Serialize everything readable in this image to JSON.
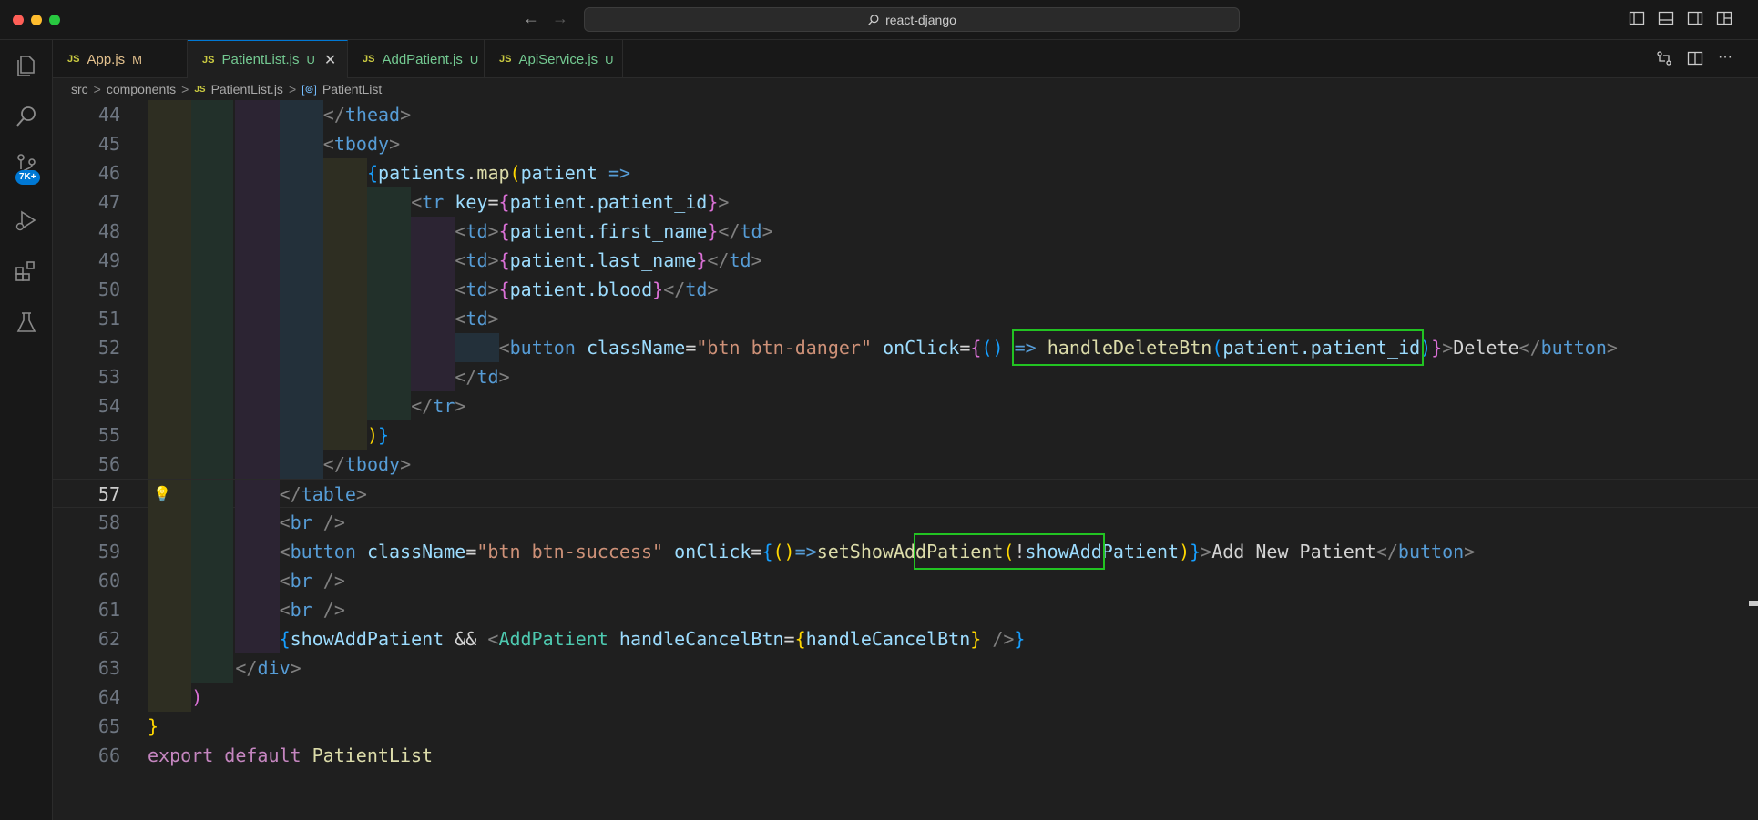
{
  "window": {
    "search_text": "react-django"
  },
  "activity": {
    "scm_badge": "7K+"
  },
  "tabs": [
    {
      "icon": "JS",
      "name": "App.js",
      "status": "M"
    },
    {
      "icon": "JS",
      "name": "PatientList.js",
      "status": "U",
      "active": true
    },
    {
      "icon": "JS",
      "name": "AddPatient.js",
      "status": "U"
    },
    {
      "icon": "JS",
      "name": "ApiService.js",
      "status": "U"
    }
  ],
  "breadcrumb": {
    "items": [
      "src",
      "components",
      "PatientList.js",
      "PatientList"
    ],
    "separator": ">",
    "file_icon": "JS"
  },
  "editor": {
    "current_line": 57,
    "lines": [
      {
        "n": "44",
        "tokens": [
          {
            "t": "</",
            "c": "tg"
          },
          {
            "t": "thead",
            "c": "tn"
          },
          {
            "t": ">",
            "c": "tg"
          }
        ]
      },
      {
        "n": "45",
        "tokens": [
          {
            "t": "<",
            "c": "tg"
          },
          {
            "t": "tbody",
            "c": "tn"
          },
          {
            "t": ">",
            "c": "tg"
          }
        ]
      },
      {
        "n": "46",
        "tokens": [
          {
            "t": "{",
            "c": "br3"
          },
          {
            "t": "patients",
            "c": "at"
          },
          {
            "t": ".",
            "c": "op"
          },
          {
            "t": "map",
            "c": "fn"
          },
          {
            "t": "(",
            "c": "br1"
          },
          {
            "t": "patient",
            "c": "at"
          },
          {
            "t": " ",
            "c": "op"
          },
          {
            "t": "=>",
            "c": "ar"
          }
        ]
      },
      {
        "n": "47",
        "tokens": [
          {
            "t": "<",
            "c": "tg"
          },
          {
            "t": "tr",
            "c": "tn"
          },
          {
            "t": " ",
            "c": "op"
          },
          {
            "t": "key",
            "c": "at"
          },
          {
            "t": "=",
            "c": "op"
          },
          {
            "t": "{",
            "c": "br2"
          },
          {
            "t": "patient.patient_id",
            "c": "at"
          },
          {
            "t": "}",
            "c": "br2"
          },
          {
            "t": ">",
            "c": "tg"
          }
        ]
      },
      {
        "n": "48",
        "tokens": [
          {
            "t": "<",
            "c": "tg"
          },
          {
            "t": "td",
            "c": "tn"
          },
          {
            "t": ">",
            "c": "tg"
          },
          {
            "t": "{",
            "c": "br2"
          },
          {
            "t": "patient.first_name",
            "c": "at"
          },
          {
            "t": "}",
            "c": "br2"
          },
          {
            "t": "</",
            "c": "tg"
          },
          {
            "t": "td",
            "c": "tn"
          },
          {
            "t": ">",
            "c": "tg"
          }
        ]
      },
      {
        "n": "49",
        "tokens": [
          {
            "t": "<",
            "c": "tg"
          },
          {
            "t": "td",
            "c": "tn"
          },
          {
            "t": ">",
            "c": "tg"
          },
          {
            "t": "{",
            "c": "br2"
          },
          {
            "t": "patient.last_name",
            "c": "at"
          },
          {
            "t": "}",
            "c": "br2"
          },
          {
            "t": "</",
            "c": "tg"
          },
          {
            "t": "td",
            "c": "tn"
          },
          {
            "t": ">",
            "c": "tg"
          }
        ]
      },
      {
        "n": "50",
        "tokens": [
          {
            "t": "<",
            "c": "tg"
          },
          {
            "t": "td",
            "c": "tn"
          },
          {
            "t": ">",
            "c": "tg"
          },
          {
            "t": "{",
            "c": "br2"
          },
          {
            "t": "patient.blood",
            "c": "at"
          },
          {
            "t": "}",
            "c": "br2"
          },
          {
            "t": "</",
            "c": "tg"
          },
          {
            "t": "td",
            "c": "tn"
          },
          {
            "t": ">",
            "c": "tg"
          }
        ]
      },
      {
        "n": "51",
        "tokens": [
          {
            "t": "<",
            "c": "tg"
          },
          {
            "t": "td",
            "c": "tn"
          },
          {
            "t": ">",
            "c": "tg"
          }
        ]
      },
      {
        "n": "52",
        "tokens": [
          {
            "t": "<",
            "c": "tg"
          },
          {
            "t": "button",
            "c": "tn"
          },
          {
            "t": " ",
            "c": "op"
          },
          {
            "t": "className",
            "c": "at"
          },
          {
            "t": "=",
            "c": "op"
          },
          {
            "t": "\"btn btn-danger\"",
            "c": "st"
          },
          {
            "t": " ",
            "c": "op"
          },
          {
            "t": "onClick",
            "c": "at"
          },
          {
            "t": "=",
            "c": "op"
          },
          {
            "t": "{",
            "c": "br2"
          },
          {
            "t": "()",
            "c": "br3"
          },
          {
            "t": " ",
            "c": "op"
          },
          {
            "t": "=>",
            "c": "ar"
          },
          {
            "t": " ",
            "c": "op"
          },
          {
            "t": "handleDeleteBtn",
            "c": "fn"
          },
          {
            "t": "(",
            "c": "br3"
          },
          {
            "t": "patient.patient_id",
            "c": "at"
          },
          {
            "t": ")",
            "c": "br3"
          },
          {
            "t": "}",
            "c": "br2"
          },
          {
            "t": ">",
            "c": "tg"
          },
          {
            "t": "Delete",
            "c": "tx"
          },
          {
            "t": "</",
            "c": "tg"
          },
          {
            "t": "button",
            "c": "tn"
          },
          {
            "t": ">",
            "c": "tg"
          }
        ]
      },
      {
        "n": "53",
        "tokens": [
          {
            "t": "</",
            "c": "tg"
          },
          {
            "t": "td",
            "c": "tn"
          },
          {
            "t": ">",
            "c": "tg"
          }
        ]
      },
      {
        "n": "54",
        "tokens": [
          {
            "t": "</",
            "c": "tg"
          },
          {
            "t": "tr",
            "c": "tn"
          },
          {
            "t": ">",
            "c": "tg"
          }
        ]
      },
      {
        "n": "55",
        "tokens": [
          {
            "t": ")",
            "c": "br1"
          },
          {
            "t": "}",
            "c": "br3"
          }
        ]
      },
      {
        "n": "56",
        "tokens": [
          {
            "t": "</",
            "c": "tg"
          },
          {
            "t": "tbody",
            "c": "tn"
          },
          {
            "t": ">",
            "c": "tg"
          }
        ]
      },
      {
        "n": "57",
        "tokens": [
          {
            "t": "</",
            "c": "tg"
          },
          {
            "t": "table",
            "c": "tn"
          },
          {
            "t": ">",
            "c": "tg"
          }
        ]
      },
      {
        "n": "58",
        "tokens": [
          {
            "t": "<",
            "c": "tg"
          },
          {
            "t": "br",
            "c": "tn"
          },
          {
            "t": " />",
            "c": "tg"
          }
        ]
      },
      {
        "n": "59",
        "tokens": [
          {
            "t": "<",
            "c": "tg"
          },
          {
            "t": "button",
            "c": "tn"
          },
          {
            "t": " ",
            "c": "op"
          },
          {
            "t": "className",
            "c": "at"
          },
          {
            "t": "=",
            "c": "op"
          },
          {
            "t": "\"btn btn-success\"",
            "c": "st"
          },
          {
            "t": " ",
            "c": "op"
          },
          {
            "t": "onClick",
            "c": "at"
          },
          {
            "t": "=",
            "c": "op"
          },
          {
            "t": "{",
            "c": "br3"
          },
          {
            "t": "()",
            "c": "br1"
          },
          {
            "t": "=>",
            "c": "ar"
          },
          {
            "t": "setShowAddPatient",
            "c": "fn"
          },
          {
            "t": "(",
            "c": "br1"
          },
          {
            "t": "!",
            "c": "op"
          },
          {
            "t": "showAddPatient",
            "c": "at"
          },
          {
            "t": ")",
            "c": "br1"
          },
          {
            "t": "}",
            "c": "br3"
          },
          {
            "t": ">",
            "c": "tg"
          },
          {
            "t": "Add New Patient",
            "c": "tx"
          },
          {
            "t": "</",
            "c": "tg"
          },
          {
            "t": "button",
            "c": "tn"
          },
          {
            "t": ">",
            "c": "tg"
          }
        ]
      },
      {
        "n": "60",
        "tokens": [
          {
            "t": "<",
            "c": "tg"
          },
          {
            "t": "br",
            "c": "tn"
          },
          {
            "t": " />",
            "c": "tg"
          }
        ]
      },
      {
        "n": "61",
        "tokens": [
          {
            "t": "<",
            "c": "tg"
          },
          {
            "t": "br",
            "c": "tn"
          },
          {
            "t": " />",
            "c": "tg"
          }
        ]
      },
      {
        "n": "62",
        "tokens": [
          {
            "t": "{",
            "c": "br3"
          },
          {
            "t": "showAddPatient",
            "c": "at"
          },
          {
            "t": " && ",
            "c": "op"
          },
          {
            "t": "<",
            "c": "tg"
          },
          {
            "t": "AddPatient",
            "c": "cp"
          },
          {
            "t": " ",
            "c": "op"
          },
          {
            "t": "handleCancelBtn",
            "c": "at"
          },
          {
            "t": "=",
            "c": "op"
          },
          {
            "t": "{",
            "c": "br1"
          },
          {
            "t": "handleCancelBtn",
            "c": "at"
          },
          {
            "t": "}",
            "c": "br1"
          },
          {
            "t": " />",
            "c": "tg"
          },
          {
            "t": "}",
            "c": "br3"
          }
        ]
      },
      {
        "n": "63",
        "tokens": [
          {
            "t": "</",
            "c": "tg"
          },
          {
            "t": "div",
            "c": "tn"
          },
          {
            "t": ">",
            "c": "tg"
          }
        ]
      },
      {
        "n": "64",
        "tokens": [
          {
            "t": ")",
            "c": "br2"
          }
        ]
      },
      {
        "n": "65",
        "tokens": [
          {
            "t": "}",
            "c": "br1"
          }
        ]
      },
      {
        "n": "66",
        "tokens": [
          {
            "t": "export",
            "c": "kw"
          },
          {
            "t": " ",
            "c": "op"
          },
          {
            "t": "default",
            "c": "kw"
          },
          {
            "t": " ",
            "c": "op"
          },
          {
            "t": "PatientList",
            "c": "fn"
          }
        ]
      }
    ]
  }
}
